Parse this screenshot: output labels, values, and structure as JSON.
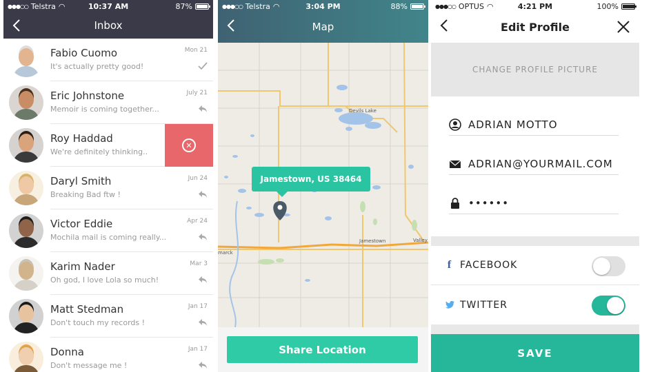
{
  "inbox": {
    "status": {
      "carrier": "Telstra",
      "time": "10:37 AM",
      "battery": "87%",
      "battery_level": 0.87
    },
    "title": "Inbox",
    "messages": [
      {
        "name": "Fabio Cuomo",
        "preview": "It's actually pretty good!",
        "date": "Mon 21",
        "icon": "check-icon"
      },
      {
        "name": "Eric Johnstone",
        "preview": "Memoir is coming together...",
        "date": "July 21",
        "icon": "reply-icon"
      },
      {
        "name": "Roy Haddad",
        "preview": "We're definitely thinking..",
        "date": "",
        "icon": "delete-icon"
      },
      {
        "name": "Daryl Smith",
        "preview": "Breaking Bad ftw !",
        "date": "Jun 24",
        "icon": "reply-icon"
      },
      {
        "name": "Victor Eddie",
        "preview": "Mochila mail is coming really...",
        "date": "Apr 24",
        "icon": "reply-icon"
      },
      {
        "name": "Karim Nader",
        "preview": "Oh god, I love Lola so much!",
        "date": "Mar 3",
        "icon": "reply-icon"
      },
      {
        "name": "Matt Stedman",
        "preview": "Don't touch my records !",
        "date": "Jan 17",
        "icon": "reply-icon"
      },
      {
        "name": "Donna",
        "preview": "Don't message me !",
        "date": "Jan 17",
        "icon": "reply-icon"
      }
    ]
  },
  "map": {
    "status": {
      "carrier": "Telstra",
      "time": "3:04 PM",
      "battery": "88%",
      "battery_level": 0.88
    },
    "title": "Map",
    "tooltip": "Jamestown, US 38464",
    "labels": {
      "devils_lake": "Devils Lake",
      "jamestown": "Jamestown",
      "valley": "Valley C",
      "bismarck": "marck"
    },
    "share_label": "Share Location"
  },
  "profile": {
    "status": {
      "carrier": "OPTUS",
      "time": "4:21 PM",
      "battery": "100%",
      "battery_level": 1.0
    },
    "title": "Edit Profile",
    "change_picture": "CHANGE PROFILE PICTURE",
    "name": "ADRIAN MOTTO",
    "email": "ADRIAN@YOURMAIL.COM",
    "password": "••••••",
    "facebook_label": "FACEBOOK",
    "facebook_on": false,
    "twitter_label": "TWITTER",
    "twitter_on": true,
    "save_label": "SAVE"
  },
  "colors": {
    "accent": "#26b79a",
    "inbox_bar": "#3a3a48",
    "delete": "#e8676b"
  }
}
